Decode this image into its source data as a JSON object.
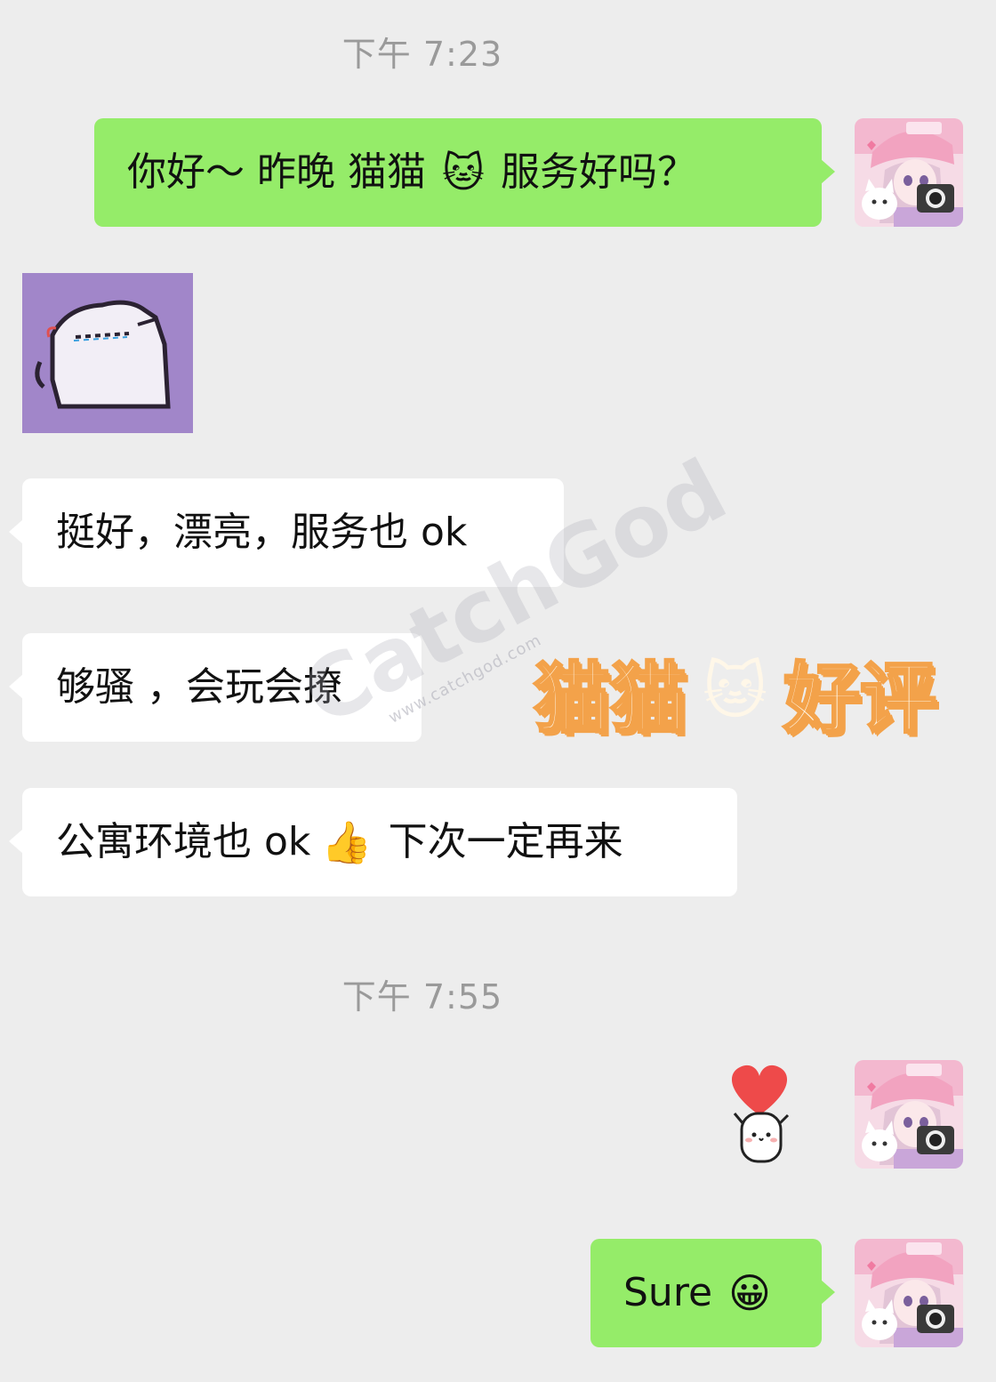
{
  "chat": {
    "time_1": "下午 7:23",
    "msg_1_text": "你好～ 昨晚 猫猫",
    "msg_1_emoji": "🐱",
    "msg_1_tail": "服务好吗？",
    "reply_1": "挺好，漂亮，服务也 ok",
    "reply_2": "够骚 ，会玩会撩",
    "reply_3_text": "公寓环境也 ok",
    "reply_3_emoji": "👍",
    "reply_3_tail": "下次一定再来",
    "time_2": "下午 7:55",
    "msg_3_text": "Sure",
    "msg_3_emoji": "😀"
  },
  "watermark": {
    "brand": "CatchGod",
    "url": "www.catchgod.com"
  },
  "overlay": {
    "left": "猫猫",
    "emoji": "🐱",
    "right": "好评"
  },
  "colors": {
    "background": "#ededed",
    "outgoing_bubble": "#95ec69",
    "incoming_bubble": "#ffffff",
    "timestamp": "#9a9a9a",
    "overlay_stroke": "#f3a24a"
  },
  "icons": {
    "avatar": "anime-girl-with-camera-avatar",
    "sticker_1": "white-cat-sticker",
    "sticker_2": "marshmallow-heart-sticker"
  }
}
